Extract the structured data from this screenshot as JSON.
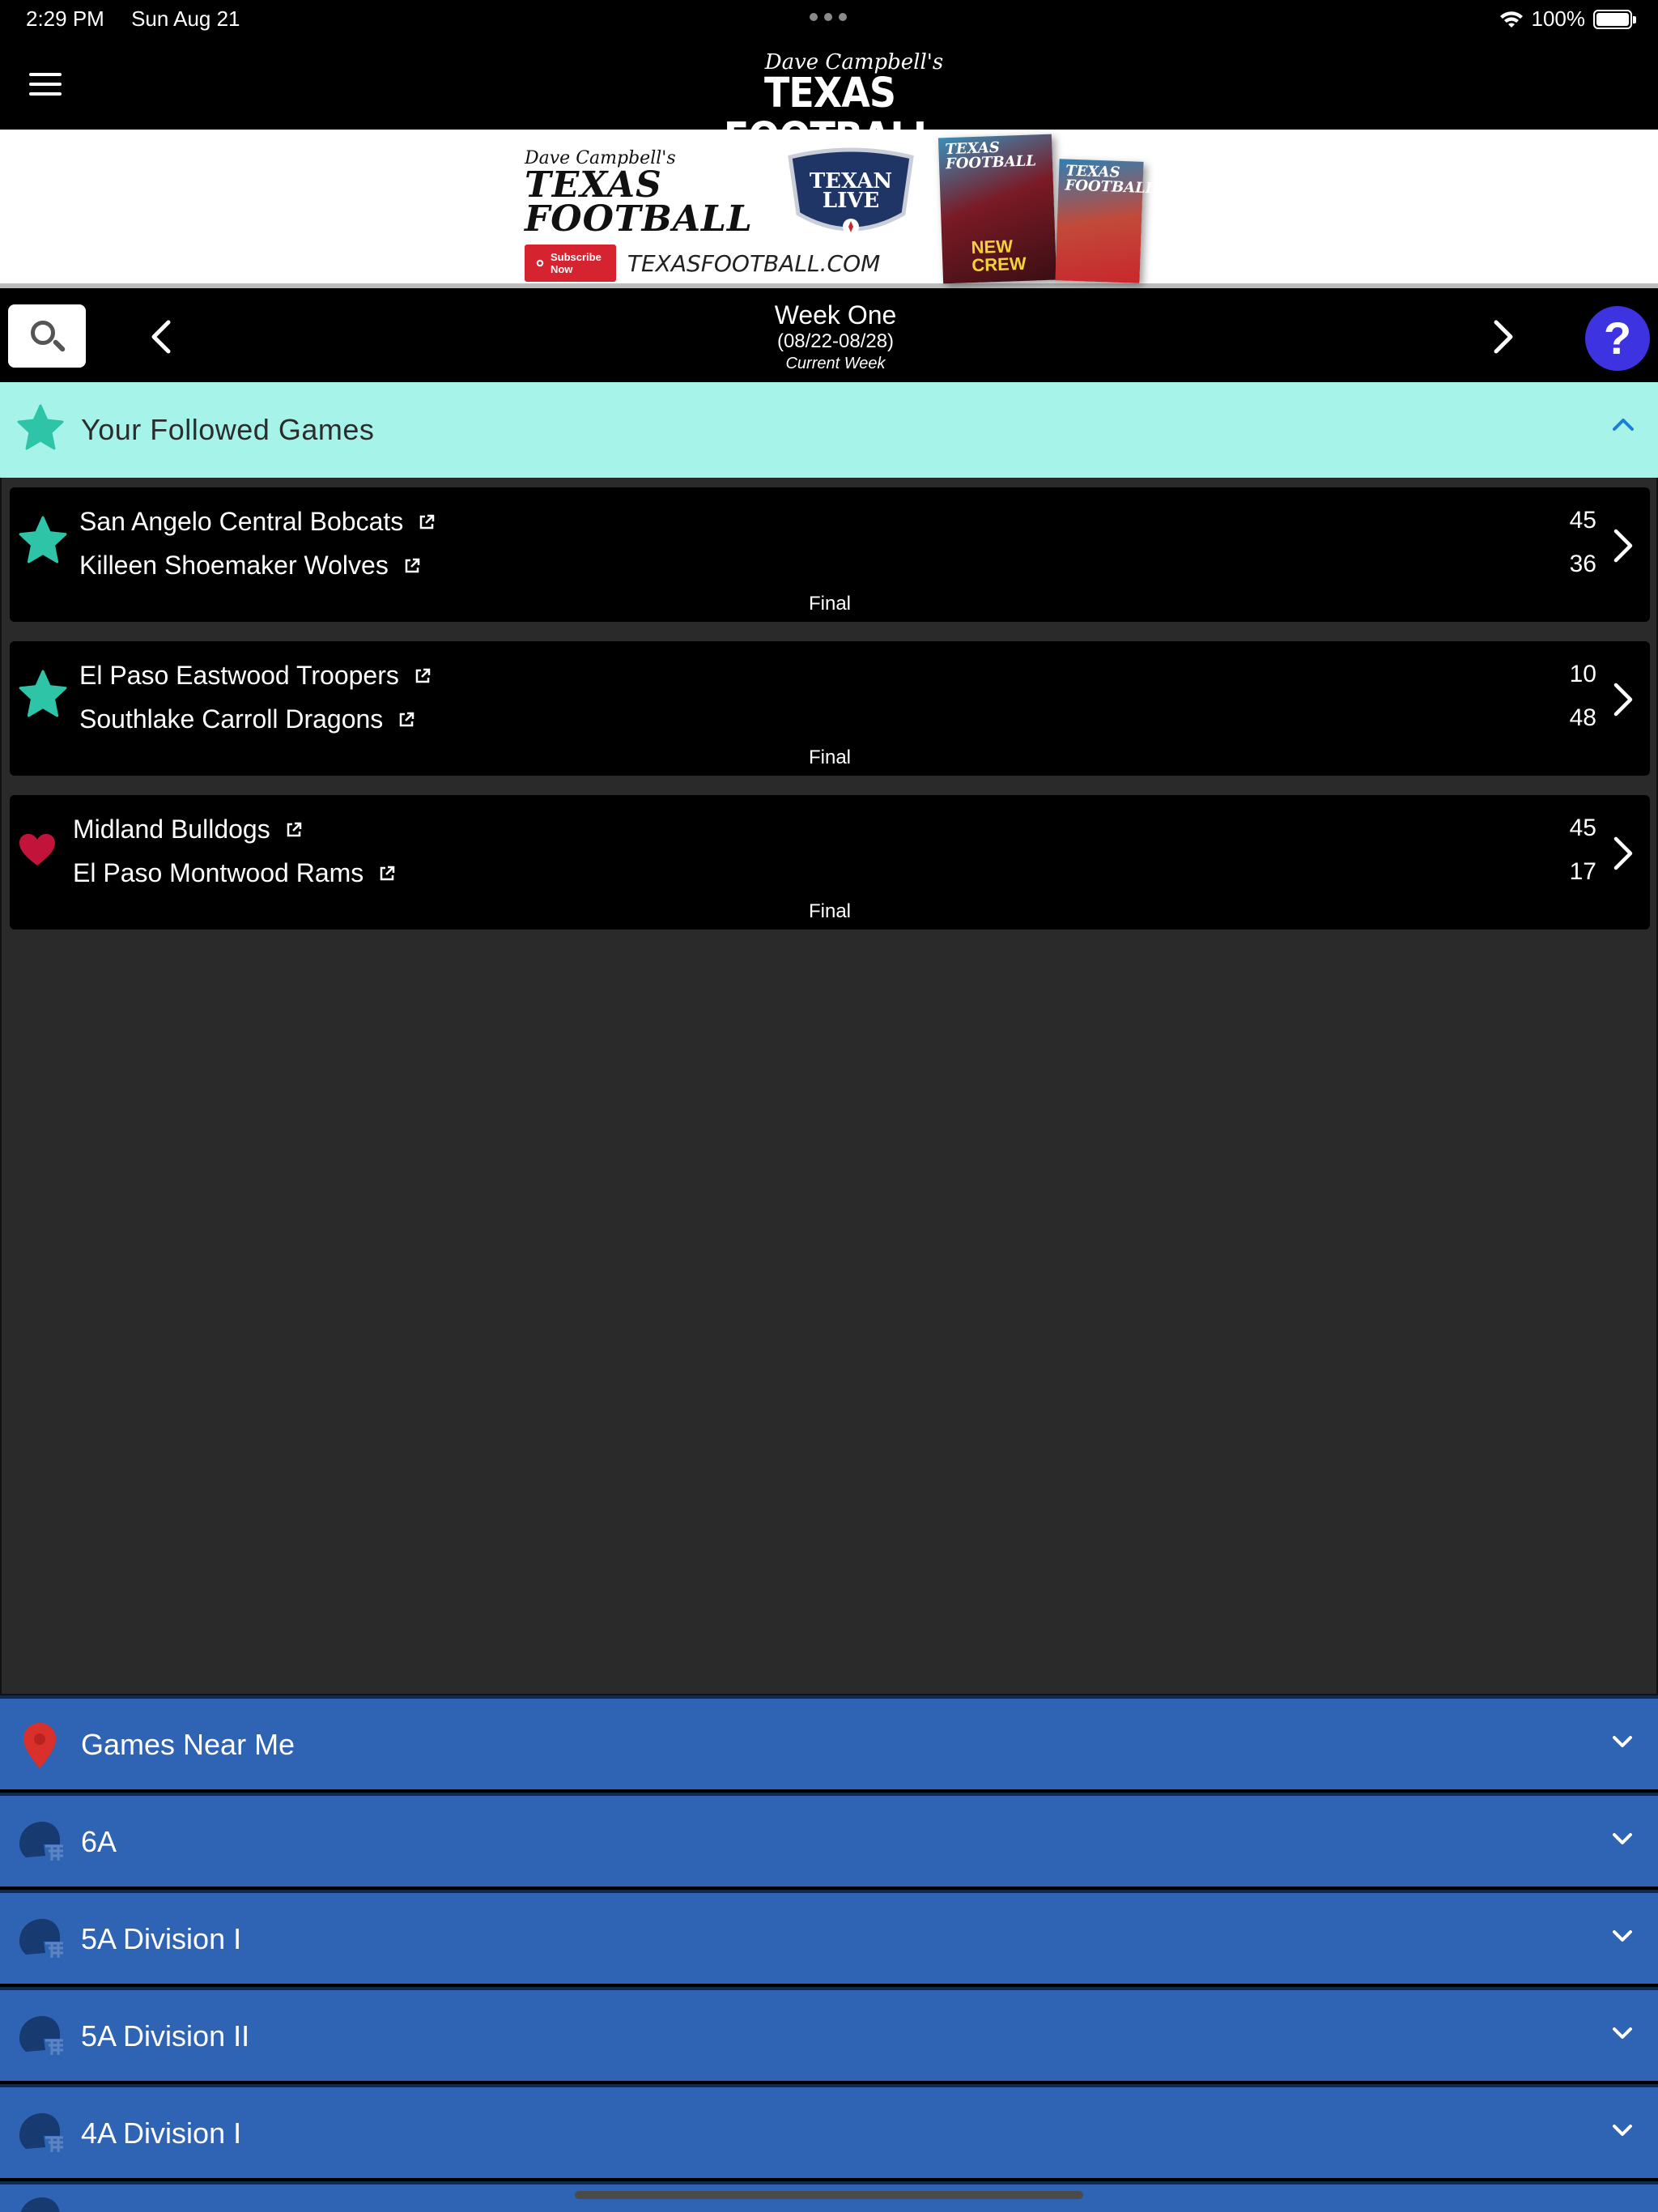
{
  "status_bar": {
    "time": "2:29 PM",
    "date": "Sun Aug 21",
    "battery": "100%",
    "battery_level": 1.0
  },
  "header": {
    "logo_script": "Dave Campbell's",
    "logo_main": "TEXAS FOOTBALL",
    "menu_icon": "hamburger-icon"
  },
  "ad": {
    "script": "Dave Campbell's",
    "title_line1": "TEXAS",
    "title_line2": "FOOTBALL",
    "subscribe_label": "Subscribe Now",
    "url": "TEXASFOOTBALL.COM",
    "shield_line1": "TEXAN",
    "shield_line2": "LIVE",
    "mag1_title": "TEXAS FOOTBALL",
    "mag1_crew": "NEW CREW",
    "mag2_title": "TEXAS FOOTBALL"
  },
  "week_nav": {
    "title": "Week One",
    "range": "(08/22-08/28)",
    "subtitle": "Current Week",
    "help_label": "?"
  },
  "followed": {
    "title": "Your Followed Games",
    "games": [
      {
        "home": "San Angelo Central Bobcats",
        "away": "Killeen Shoemaker Wolves",
        "home_score": "45",
        "away_score": "36",
        "status": "Final",
        "icon": "star-icon"
      },
      {
        "home": "El Paso Eastwood Troopers",
        "away": "Southlake Carroll Dragons",
        "home_score": "10",
        "away_score": "48",
        "status": "Final",
        "icon": "star-icon"
      },
      {
        "home": "Midland Bulldogs",
        "away": "El Paso Montwood Rams",
        "home_score": "45",
        "away_score": "17",
        "status": "Final",
        "icon": "heart-icon"
      }
    ]
  },
  "sections": [
    {
      "label": "Games Near Me",
      "icon": "location-pin-icon"
    },
    {
      "label": "6A",
      "icon": "helmet-icon"
    },
    {
      "label": "5A Division I",
      "icon": "helmet-icon"
    },
    {
      "label": "5A Division II",
      "icon": "helmet-icon"
    },
    {
      "label": "4A Division I",
      "icon": "helmet-icon"
    }
  ],
  "colors": {
    "followed_header_bg": "#a6f4e9",
    "section_bg": "#2f63b3",
    "star": "#2ec4a8",
    "heart": "#c2143a",
    "help_button": "#3d33e0",
    "pin": "#d9302b"
  }
}
